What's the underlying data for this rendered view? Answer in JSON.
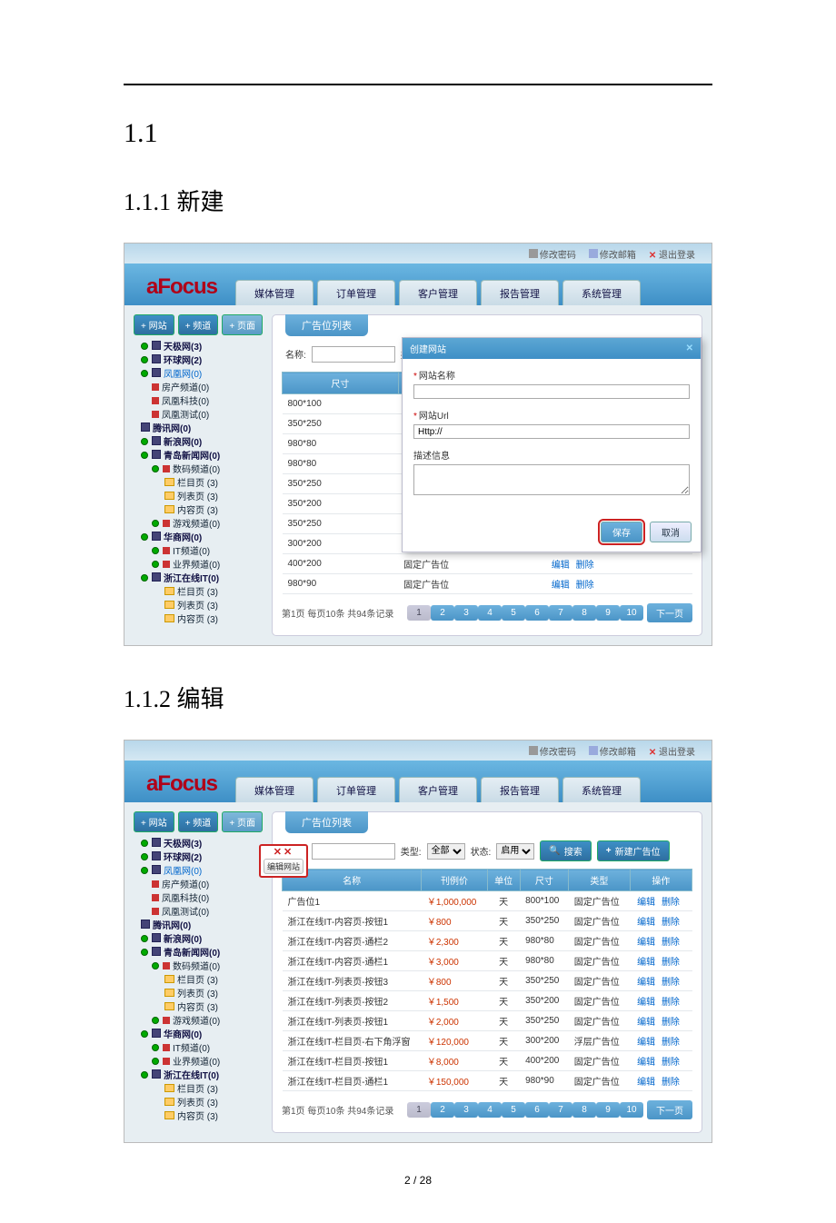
{
  "headings": {
    "h1": "1.1",
    "h2a": "1.1.1 新建",
    "h2b": "1.1.2 编辑"
  },
  "footer": "2  /  28",
  "brand": "aFocus",
  "topbar": {
    "pwd": "修改密码",
    "mail": "修改邮箱",
    "logout": "退出登录"
  },
  "nav": [
    "媒体管理",
    "订单管理",
    "客户管理",
    "报告管理",
    "系统管理"
  ],
  "sidebtns": {
    "site": "+ 网站",
    "channel": "+ 频道",
    "page": "+ 页面"
  },
  "tree": [
    {
      "lvl": 1,
      "cls": "sq",
      "text": "天极网(3)",
      "dot": true,
      "bold": true
    },
    {
      "lvl": 1,
      "cls": "sq",
      "text": "环球网(2)",
      "dot": true,
      "bold": true
    },
    {
      "lvl": 1,
      "cls": "sq",
      "text": "凤凰网(0)",
      "dot": true,
      "bold": true,
      "link": true
    },
    {
      "lvl": 2,
      "cls": "m",
      "text": "房产频道(0)"
    },
    {
      "lvl": 2,
      "cls": "m",
      "text": "凤凰科技(0)"
    },
    {
      "lvl": 2,
      "cls": "m",
      "text": "凤凰测试(0)"
    },
    {
      "lvl": 1,
      "cls": "sq",
      "text": "腾讯网(0)",
      "bold": true
    },
    {
      "lvl": 1,
      "cls": "sq",
      "text": "新浪网(0)",
      "dot": true,
      "bold": true
    },
    {
      "lvl": 1,
      "cls": "sq",
      "text": "青岛新闻网(0)",
      "dot": true,
      "bold": true
    },
    {
      "lvl": 2,
      "cls": "m",
      "text": "数码频道(0)",
      "dot": true
    },
    {
      "lvl": 3,
      "cls": "fd",
      "text": "栏目页  (3)"
    },
    {
      "lvl": 3,
      "cls": "fd",
      "text": "列表页  (3)"
    },
    {
      "lvl": 3,
      "cls": "fd",
      "text": "内容页  (3)"
    },
    {
      "lvl": 2,
      "cls": "m",
      "text": "游戏频道(0)",
      "dot": true
    },
    {
      "lvl": 1,
      "cls": "sq",
      "text": "华商网(0)",
      "dot": true,
      "bold": true
    },
    {
      "lvl": 2,
      "cls": "m",
      "text": "IT频道(0)",
      "dot": true
    },
    {
      "lvl": 2,
      "cls": "m",
      "text": "业界频道(0)",
      "dot": true
    },
    {
      "lvl": 1,
      "cls": "sq",
      "text": "浙江在线IT(0)",
      "dot": true,
      "bold": true
    },
    {
      "lvl": 3,
      "cls": "fd",
      "text": "栏目页  (3)"
    },
    {
      "lvl": 3,
      "cls": "fd",
      "text": "列表页  (3)"
    },
    {
      "lvl": 3,
      "cls": "fd",
      "text": "内容页  (3)"
    }
  ],
  "main": {
    "tab": "广告位列表",
    "filter": {
      "name_lbl": "名称:",
      "type_lbl": "类型:",
      "type_val": "全部",
      "state_lbl": "状态:",
      "state_val": "启用",
      "search": "搜索",
      "create": "新建广告位"
    },
    "cols": [
      "名称",
      "刊例价",
      "单位",
      "尺寸",
      "类型",
      "操作"
    ],
    "act": {
      "edit": "编辑",
      "del": "删除"
    },
    "pager": {
      "info": "第1页 每页10条 共94条记录",
      "pages": [
        "1",
        "2",
        "3",
        "4",
        "5",
        "6",
        "7",
        "8",
        "9",
        "10"
      ],
      "next": "下一页"
    }
  },
  "rows1": [
    {
      "size": "800*100",
      "type": "固定广告位"
    },
    {
      "size": "350*250",
      "type": "固定广告位"
    },
    {
      "size": "980*80",
      "type": "固定广告位"
    },
    {
      "size": "980*80",
      "type": "固定广告位"
    },
    {
      "size": "350*250",
      "type": "固定广告位"
    },
    {
      "size": "350*200",
      "type": "固定广告位"
    },
    {
      "size": "350*250",
      "type": "固定广告位"
    },
    {
      "size": "300*200",
      "type": "浮层广告位"
    },
    {
      "size": "400*200",
      "type": "固定广告位"
    },
    {
      "size": "980*90",
      "type": "固定广告位"
    }
  ],
  "modal": {
    "title": "创建网站",
    "name_lbl": "网站名称",
    "url_lbl": "网站Url",
    "url_val": "Http://",
    "desc_lbl": "描述信息",
    "save": "保存",
    "cancel": "取消"
  },
  "rows2": [
    {
      "name": "广告位1",
      "price": "￥1,000,000",
      "unit": "天",
      "size": "800*100",
      "type": "固定广告位"
    },
    {
      "name": "浙江在线IT-内容页-按钮1",
      "price": "￥800",
      "unit": "天",
      "size": "350*250",
      "type": "固定广告位"
    },
    {
      "name": "浙江在线IT-内容页-通栏2",
      "price": "￥2,300",
      "unit": "天",
      "size": "980*80",
      "type": "固定广告位"
    },
    {
      "name": "浙江在线IT-内容页-通栏1",
      "price": "￥3,000",
      "unit": "天",
      "size": "980*80",
      "type": "固定广告位"
    },
    {
      "name": "浙江在线IT-列表页-按钮3",
      "price": "￥800",
      "unit": "天",
      "size": "350*250",
      "type": "固定广告位"
    },
    {
      "name": "浙江在线IT-列表页-按钮2",
      "price": "￥1,500",
      "unit": "天",
      "size": "350*200",
      "type": "固定广告位"
    },
    {
      "name": "浙江在线IT-列表页-按钮1",
      "price": "￥2,000",
      "unit": "天",
      "size": "350*250",
      "type": "固定广告位"
    },
    {
      "name": "浙江在线IT-栏目页-右下角浮窗",
      "price": "￥120,000",
      "unit": "天",
      "size": "300*200",
      "type": "浮层广告位"
    },
    {
      "name": "浙江在线IT-栏目页-按钮1",
      "price": "￥8,000",
      "unit": "天",
      "size": "400*200",
      "type": "固定广告位"
    },
    {
      "name": "浙江在线IT-栏目页-通栏1",
      "price": "￥150,000",
      "unit": "天",
      "size": "980*90",
      "type": "固定广告位"
    }
  ],
  "pop": {
    "x": "✕✕",
    "btn": "编辑网站"
  }
}
